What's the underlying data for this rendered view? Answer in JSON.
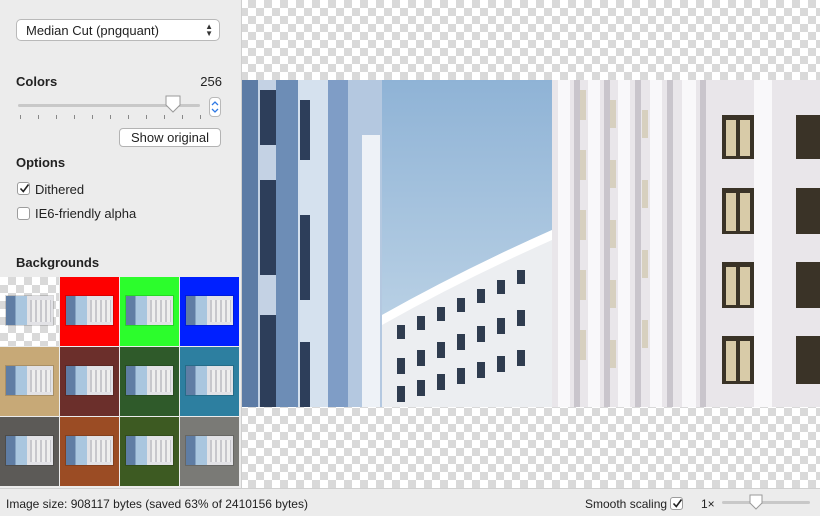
{
  "algorithm_select": {
    "value": "Median Cut (pngquant)"
  },
  "colors": {
    "label": "Colors",
    "value": "256",
    "level": 0.85
  },
  "show_original_label": "Show original",
  "options": {
    "heading": "Options",
    "dithered": {
      "label": "Dithered",
      "checked": true
    },
    "ie6_alpha": {
      "label": "IE6-friendly alpha",
      "checked": false
    }
  },
  "backgrounds": {
    "heading": "Backgrounds",
    "tiles": [
      {
        "name": "checkerboard",
        "color": "checker"
      },
      {
        "name": "red",
        "color": "#fe0000"
      },
      {
        "name": "green",
        "color": "#2cfd2c"
      },
      {
        "name": "blue",
        "color": "#0020ff"
      },
      {
        "name": "sand",
        "color": "#c7a977"
      },
      {
        "name": "maroon-texture",
        "color": "#6b2f2b"
      },
      {
        "name": "foliage",
        "color": "#2f5a2a"
      },
      {
        "name": "water",
        "color": "#2d7fa0"
      },
      {
        "name": "stones",
        "color": "#5c5a57"
      },
      {
        "name": "rust",
        "color": "#9b4c24"
      },
      {
        "name": "grass",
        "color": "#3d5a22"
      },
      {
        "name": "gray-pattern",
        "color": "#7a7a76"
      }
    ]
  },
  "status": {
    "image_size": "Image size: 908117 bytes (saved 63% of 2410156 bytes)",
    "smooth_scaling": {
      "label": "Smooth scaling",
      "checked": true
    },
    "zoom": {
      "label": "1×",
      "level": 0.37
    }
  }
}
